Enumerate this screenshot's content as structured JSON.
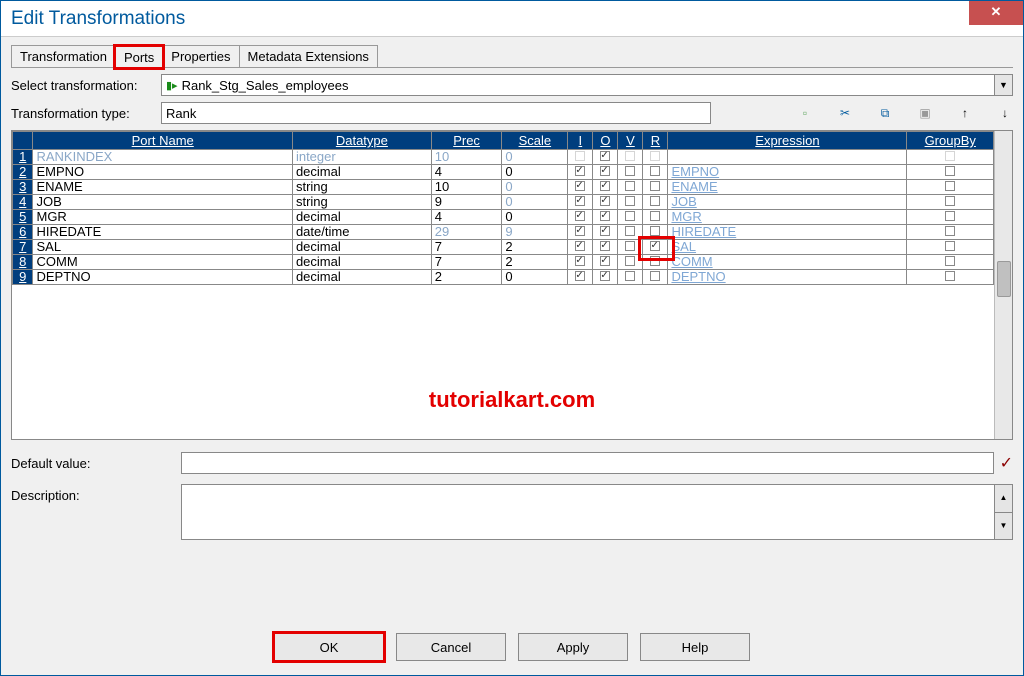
{
  "window": {
    "title": "Edit Transformations",
    "close_glyph": "✕"
  },
  "tabs": {
    "transformation": "Transformation",
    "ports": "Ports",
    "properties": "Properties",
    "metadata": "Metadata Extensions"
  },
  "labels": {
    "select_transformation": "Select transformation:",
    "transformation_type": "Transformation type:",
    "default_value": "Default value:",
    "description": "Description:"
  },
  "fields": {
    "transformation_name": "Rank_Stg_Sales_employees",
    "transformation_type": "Rank"
  },
  "toolbar": {
    "new_icon_title": "New port",
    "cut_icon_title": "Cut",
    "copy_icon_title": "Copy",
    "paste_icon_title": "Paste",
    "up_icon_title": "Move up",
    "down_icon_title": "Move down"
  },
  "columns": {
    "port_name": "Port Name",
    "datatype": "Datatype",
    "prec": "Prec",
    "scale": "Scale",
    "i": "I",
    "o": "O",
    "v": "V",
    "r": "R",
    "expression": "Expression",
    "groupby": "GroupBy"
  },
  "rows": [
    {
      "n": "1",
      "name": "RANKINDEX",
      "dim": true,
      "dtype": "integer",
      "dtype_dim": true,
      "prec": "10",
      "prec_dim": true,
      "scale": "0",
      "scale_dim": true,
      "i": false,
      "o": true,
      "v": false,
      "r": false,
      "expr": "",
      "group": false,
      "i_enabled": false,
      "v_enabled": false,
      "r_enabled": false
    },
    {
      "n": "2",
      "name": "EMPNO",
      "dim": false,
      "dtype": "decimal",
      "prec": "4",
      "scale": "0",
      "i": true,
      "o": true,
      "v": false,
      "r": false,
      "expr": "EMPNO",
      "group": false
    },
    {
      "n": "3",
      "name": "ENAME",
      "dim": false,
      "dtype": "string",
      "prec": "10",
      "scale": "0",
      "scale_dim": true,
      "i": true,
      "o": true,
      "v": false,
      "r": false,
      "expr": "ENAME",
      "group": false
    },
    {
      "n": "4",
      "name": "JOB",
      "dim": false,
      "dtype": "string",
      "prec": "9",
      "scale": "0",
      "scale_dim": true,
      "i": true,
      "o": true,
      "v": false,
      "r": false,
      "expr": "JOB",
      "group": false
    },
    {
      "n": "5",
      "name": "MGR",
      "dim": false,
      "dtype": "decimal",
      "prec": "4",
      "scale": "0",
      "i": true,
      "o": true,
      "v": false,
      "r": false,
      "expr": "MGR",
      "group": false
    },
    {
      "n": "6",
      "name": "HIREDATE",
      "dim": false,
      "dtype": "date/time",
      "prec": "29",
      "prec_dim": true,
      "scale": "9",
      "scale_dim": true,
      "i": true,
      "o": true,
      "v": false,
      "r": false,
      "expr": "HIREDATE",
      "group": false
    },
    {
      "n": "7",
      "name": "SAL",
      "dim": false,
      "dtype": "decimal",
      "prec": "7",
      "scale": "2",
      "i": true,
      "o": true,
      "v": false,
      "r": true,
      "expr": "SAL",
      "group": false
    },
    {
      "n": "8",
      "name": "COMM",
      "dim": false,
      "dtype": "decimal",
      "prec": "7",
      "scale": "2",
      "i": true,
      "o": true,
      "v": false,
      "r": false,
      "expr": "COMM",
      "group": false
    },
    {
      "n": "9",
      "name": "DEPTNO",
      "dim": false,
      "dtype": "decimal",
      "prec": "2",
      "scale": "0",
      "i": true,
      "o": true,
      "v": false,
      "r": false,
      "expr": "DEPTNO",
      "group": false
    }
  ],
  "watermark": "tutorialkart.com",
  "buttons": {
    "ok": "OK",
    "cancel": "Cancel",
    "apply": "Apply",
    "help": "Help"
  }
}
